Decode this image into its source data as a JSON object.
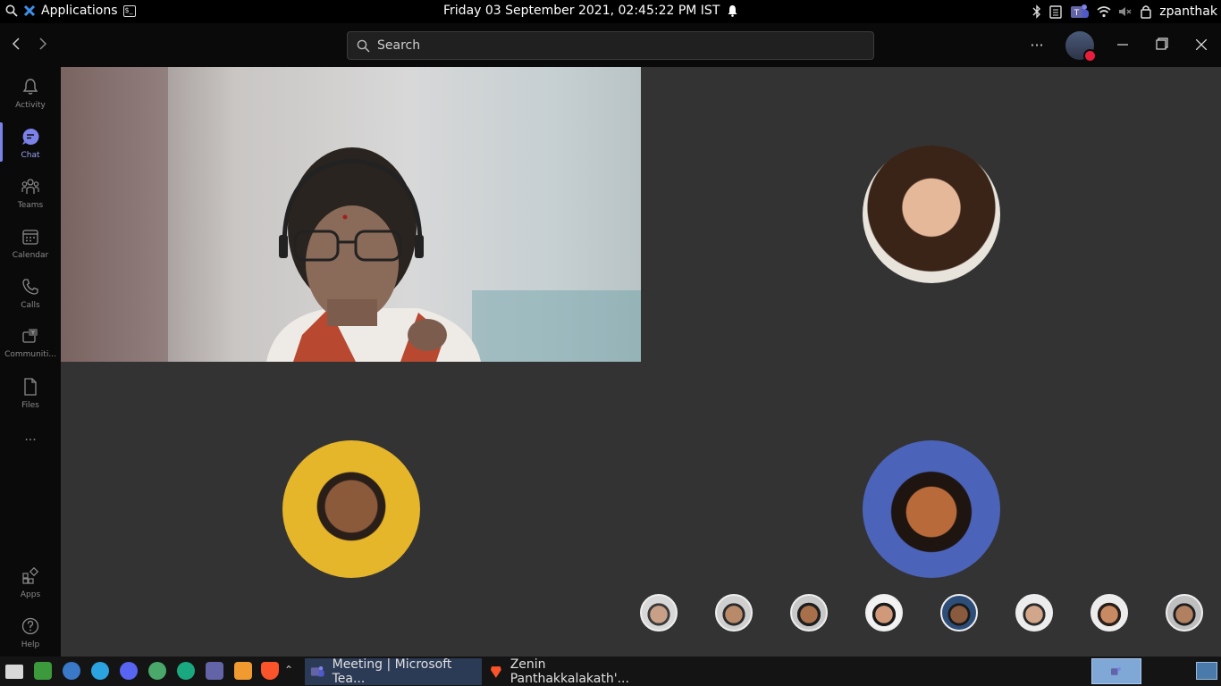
{
  "system_bar": {
    "applications_label": "Applications",
    "datetime": "Friday 03 September 2021, 02:45:22 PM IST",
    "username": "zpanthak"
  },
  "titlebar": {
    "search_placeholder": "Search",
    "more_label": "···"
  },
  "rail": {
    "items": [
      {
        "label": "Activity",
        "icon": "bell-icon"
      },
      {
        "label": "Chat",
        "icon": "chat-icon"
      },
      {
        "label": "Teams",
        "icon": "teams-icon"
      },
      {
        "label": "Calendar",
        "icon": "calendar-icon"
      },
      {
        "label": "Calls",
        "icon": "phone-icon"
      },
      {
        "label": "Communiti...",
        "icon": "communities-icon"
      },
      {
        "label": "Files",
        "icon": "file-icon"
      },
      {
        "label": "Apps",
        "icon": "apps-icon"
      },
      {
        "label": "Help",
        "icon": "help-icon"
      }
    ],
    "more_label": "···"
  },
  "taskbar": {
    "tasks": [
      {
        "label": "Meeting | Microsoft Tea..."
      },
      {
        "label": "Zenin Panthakkalakath'..."
      }
    ]
  },
  "colors": {
    "accent": "#7b83eb",
    "tile_bg": "#333333",
    "status_busy": "#e81e3c"
  }
}
